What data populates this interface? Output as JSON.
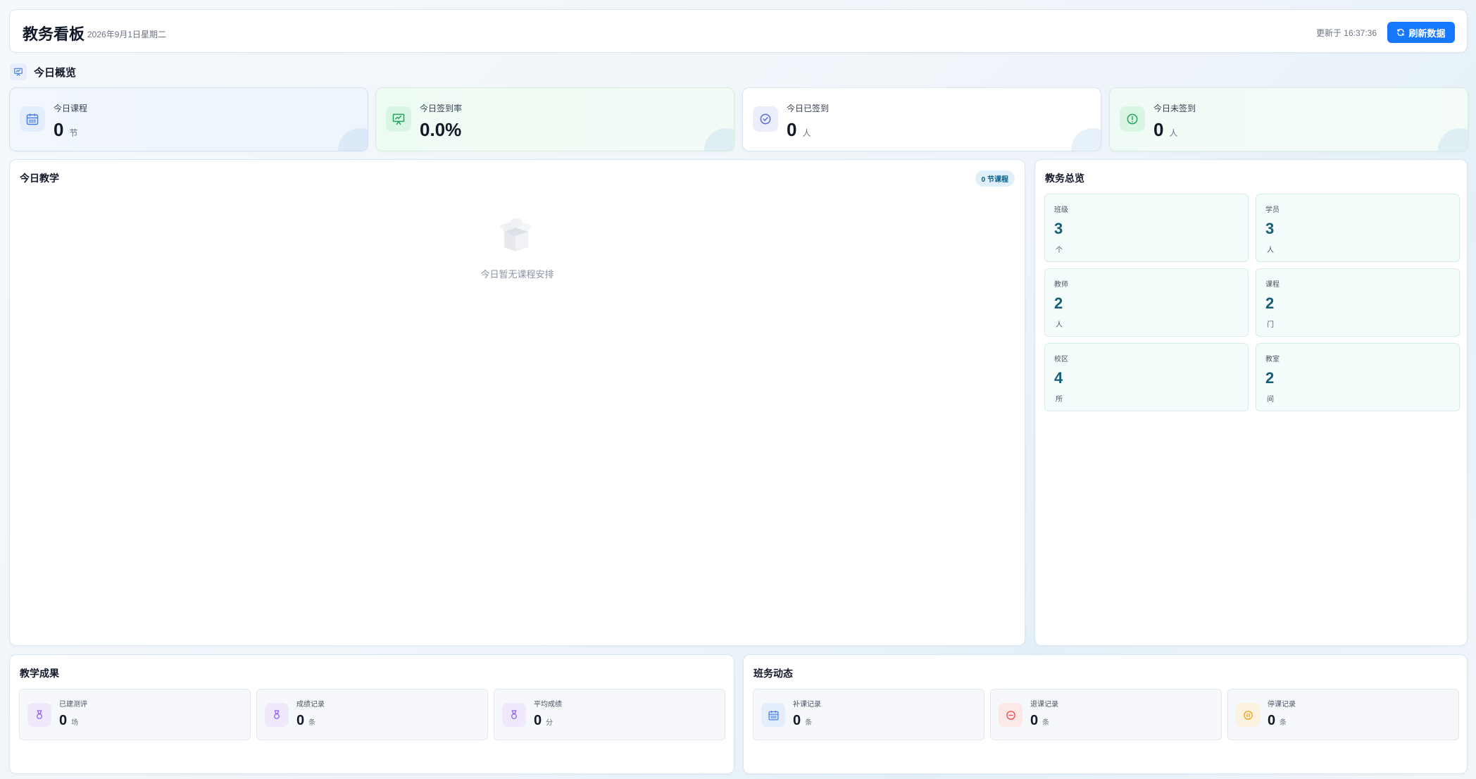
{
  "header": {
    "title": "教务看板",
    "date": "2026年9月1日星期二",
    "updated": "更新于 16:37:36",
    "refresh_label": "刷新数据"
  },
  "overview_section": {
    "title": "今日概览"
  },
  "stats": [
    {
      "label": "今日课程",
      "value": "0",
      "unit": "节",
      "icon": "calendar-icon",
      "color": "#4a7fe0"
    },
    {
      "label": "今日签到率",
      "value": "0.0%",
      "unit": "",
      "icon": "presentation-chart-icon",
      "color": "#22a35a"
    },
    {
      "label": "今日已签到",
      "value": "0",
      "unit": "人",
      "icon": "check-circle-icon",
      "color": "#5b6bd8"
    },
    {
      "label": "今日未签到",
      "value": "0",
      "unit": "人",
      "icon": "alert-circle-icon",
      "color": "#22a35a"
    }
  ],
  "teaching": {
    "title": "今日教学",
    "badge": "0 节课程",
    "empty_text": "今日暂无课程安排"
  },
  "academic_overview": {
    "title": "教务总览",
    "items": [
      {
        "label": "班级",
        "value": "3",
        "unit": "个"
      },
      {
        "label": "学员",
        "value": "3",
        "unit": "人"
      },
      {
        "label": "教师",
        "value": "2",
        "unit": "人"
      },
      {
        "label": "课程",
        "value": "2",
        "unit": "门"
      },
      {
        "label": "校区",
        "value": "4",
        "unit": "所"
      },
      {
        "label": "教室",
        "value": "2",
        "unit": "间"
      }
    ]
  },
  "results": {
    "title": "教学成果",
    "items": [
      {
        "label": "已建测评",
        "value": "0",
        "unit": "场",
        "icon": "medal-icon"
      },
      {
        "label": "成绩记录",
        "value": "0",
        "unit": "条",
        "icon": "medal-icon"
      },
      {
        "label": "平均成绩",
        "value": "0",
        "unit": "分",
        "icon": "medal-icon"
      }
    ]
  },
  "dynamics": {
    "title": "班务动态",
    "items": [
      {
        "label": "补课记录",
        "value": "0",
        "unit": "条",
        "icon": "calendar-icon"
      },
      {
        "label": "退课记录",
        "value": "0",
        "unit": "条",
        "icon": "minus-circle-icon"
      },
      {
        "label": "停课记录",
        "value": "0",
        "unit": "条",
        "icon": "pause-circle-icon"
      }
    ]
  }
}
